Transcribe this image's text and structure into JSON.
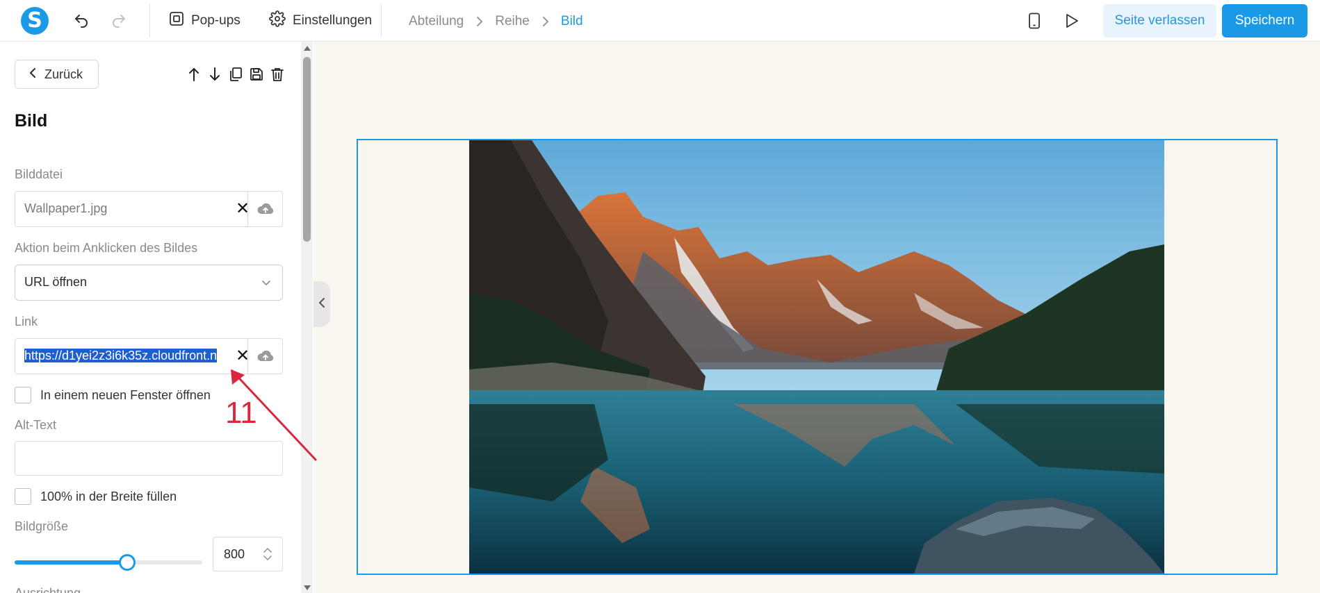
{
  "topbar": {
    "logo_letter": "S",
    "popups_label": "Pop-ups",
    "settings_label": "Einstellungen",
    "breadcrumb": [
      "Abteilung",
      "Reihe",
      "Bild"
    ],
    "leave_label": "Seite verlassen",
    "save_label": "Speichern"
  },
  "sidebar": {
    "back_label": "Zurück",
    "title": "Bild",
    "image_file": {
      "label": "Bilddatei",
      "value": "Wallpaper1.jpg",
      "clear": "✕"
    },
    "click_action": {
      "label": "Aktion beim Anklicken des Bildes",
      "value": "URL öffnen"
    },
    "link": {
      "label": "Link",
      "value": "https://d1yei2z3i6k35z.cloudfront.n",
      "clear": "✕"
    },
    "new_window": {
      "label": "In einem neuen Fenster öffnen",
      "checked": false
    },
    "alt_text": {
      "label": "Alt-Text",
      "value": ""
    },
    "full_width": {
      "label": "100% in der Breite füllen",
      "checked": false
    },
    "image_size": {
      "label": "Bildgröße",
      "value": "800",
      "slider_fraction": 0.6
    },
    "alignment_label": "Ausrichtung"
  },
  "annotation": {
    "number": "11"
  },
  "colors": {
    "accent": "#1a9ae6",
    "canvas_bg": "#f8f6ef",
    "annotation": "#d9273e",
    "selection": "#1d5fd1"
  }
}
